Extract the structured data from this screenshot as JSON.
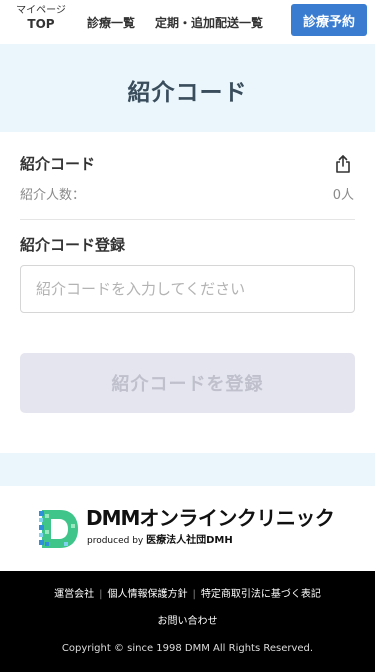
{
  "header": {
    "mypage_small": "マイページ",
    "mypage_big": "TOP",
    "nav_list": "診療一覧",
    "nav_subscription": "定期・追加配送一覧",
    "reserve_button": "診療予約"
  },
  "page": {
    "title": "紹介コード"
  },
  "referral": {
    "code_label": "紹介コード",
    "count_label": "紹介人数：",
    "count_value": "0人"
  },
  "registration": {
    "label": "紹介コード登録",
    "input_placeholder": "紹介コードを入力してください",
    "input_value": "",
    "submit_label": "紹介コードを登録"
  },
  "logo": {
    "title_latin": "DMM",
    "title_jp": "オンラインクリニック",
    "sub_produced": "produced by",
    "sub_org": "医療法人社団DMH"
  },
  "footer": {
    "links": [
      "運営会社",
      "個人情報保護方針",
      "特定商取引法に基づく表記"
    ],
    "contact": "お問い合わせ",
    "copyright": "Copyright © since 1998 DMM All Rights Reserved."
  },
  "colors": {
    "accent": "#3a7dd0",
    "band": "#eaf6fb",
    "disabled_button": "#e4e5ef",
    "logo_green": "#3fc48a",
    "logo_blue": "#2f8fd8"
  }
}
